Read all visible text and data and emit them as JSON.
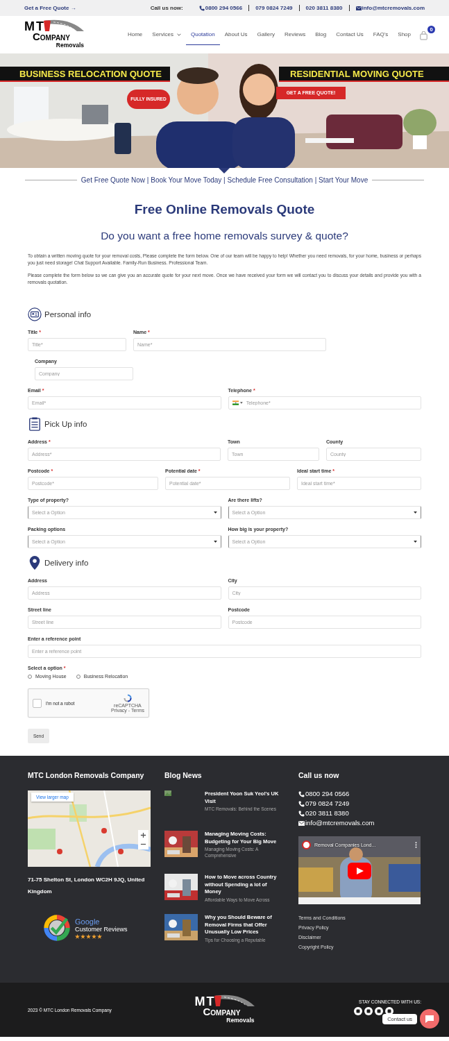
{
  "topbar": {
    "quote_link": "Get a Free Quote →",
    "call_label": "Call us now:",
    "phones": [
      "0800 294 0566",
      "079 0824 7249",
      "020 3811 8380"
    ],
    "email": "info@mtcremovals.com"
  },
  "header": {
    "logo": {
      "mark": "MT",
      "name": "COMPANY",
      "sub": "Removals"
    },
    "nav": [
      {
        "label": "Home",
        "selected": false,
        "dropdown": false
      },
      {
        "label": "Services",
        "selected": false,
        "dropdown": true
      },
      {
        "label": "Quotation",
        "selected": true,
        "dropdown": false
      },
      {
        "label": "About Us",
        "selected": false,
        "dropdown": false
      },
      {
        "label": "Gallery",
        "selected": false,
        "dropdown": false
      },
      {
        "label": "Reviews",
        "selected": false,
        "dropdown": false
      },
      {
        "label": "Blog",
        "selected": false,
        "dropdown": false
      },
      {
        "label": "Contact Us",
        "selected": false,
        "dropdown": false
      },
      {
        "label": "FAQ's",
        "selected": false,
        "dropdown": false
      },
      {
        "label": "Shop",
        "selected": false,
        "dropdown": false
      }
    ],
    "cart_count": "0"
  },
  "hero": {
    "kind": "picture",
    "left_banner": "BUSINESS RELOCATION QUOTE",
    "right_banner": "RESIDENTIAL MOVING QUOTE",
    "badge": "FULLY INSURED",
    "button": "GET A FREE QUOTE!"
  },
  "tagline": "Get Free Quote Now | Book Your Move Today | Schedule Free Consultation | Start Your Move",
  "title": "Free Online Removals Quote",
  "subtitle": "Do you want a free home removals survey & quote?",
  "intro": [
    "To obtain a written moving quote for your removal costs, Please complete the form below. One of our team will be happy to help! Whether you need removals, for your home, business or perhaps you just need storage! Chat Support Available. Family-Run Business. Professional Team.",
    "Please complete the form below so we can give you an accurate quote for your next move. Once we have received your form we will contact you to discuss your details and provide you with a removals quotation."
  ],
  "form": {
    "sections": [
      {
        "kind": "person",
        "title": "Personal info",
        "rows": [
          [
            {
              "kind": "text",
              "label": "Title",
              "mark": "*",
              "placeholder": "Title*"
            },
            {
              "kind": "text",
              "label": "Name",
              "mark": "*",
              "placeholder": "Name*"
            }
          ],
          [
            {
              "kind": "text",
              "label": "Company",
              "placeholder": "Company"
            }
          ],
          [
            {
              "kind": "text",
              "label": "Email",
              "mark": "*",
              "placeholder": "Email*"
            },
            {
              "kind": "phone",
              "label": "Telephone",
              "mark": "*",
              "placeholder": "Telephone*"
            }
          ]
        ]
      },
      {
        "kind": "list",
        "title": "Pick Up info",
        "rows": [
          [
            {
              "kind": "text",
              "label": "Address",
              "mark": "*",
              "placeholder": "Address*"
            },
            {
              "kind": "text",
              "label": "Town",
              "placeholder": "Town"
            },
            {
              "kind": "text",
              "label": "County",
              "placeholder": "County"
            }
          ],
          [
            {
              "kind": "text",
              "label": "Postcode",
              "mark": "*",
              "placeholder": "Postcode*"
            },
            {
              "kind": "text",
              "label": "Potential date",
              "mark": "*",
              "placeholder": "Potential date*"
            },
            {
              "kind": "text",
              "label": "Ideal start time",
              "mark": "*",
              "placeholder": "Ideal start time*"
            }
          ],
          [
            {
              "kind": "select",
              "label": "Type of property?",
              "placeholder": "Select a Option"
            },
            {
              "kind": "select",
              "label": "Are there lifts?",
              "placeholder": "Select a Option"
            }
          ],
          [
            {
              "kind": "select",
              "label": "Packing options",
              "placeholder": "Select a Option"
            },
            {
              "kind": "select",
              "label": "How big is your property?",
              "placeholder": "Select a Option"
            }
          ]
        ]
      },
      {
        "kind": "pin",
        "title": "Delivery info",
        "rows": [
          [
            {
              "kind": "text",
              "label": "Address",
              "placeholder": "Address"
            },
            {
              "kind": "text",
              "label": "City",
              "placeholder": "City"
            }
          ],
          [
            {
              "kind": "text",
              "label": "Street line",
              "placeholder": "Street line"
            },
            {
              "kind": "text",
              "label": "Postcode",
              "placeholder": "Postcode"
            }
          ],
          [
            {
              "kind": "text",
              "label": "Enter a reference point",
              "placeholder": "Enter a reference point"
            }
          ]
        ]
      }
    ],
    "choice": {
      "label": "Select a option",
      "mark": "*",
      "options": [
        {
          "label": "Moving House",
          "selected": false
        },
        {
          "label": "Business Relocation",
          "selected": false
        }
      ]
    },
    "captcha": {
      "label": "I'm not a robot",
      "checked": false,
      "brand": "reCAPTCHA",
      "links": "Privacy - Terms"
    },
    "submit": "Send"
  },
  "footer": {
    "company": {
      "title": "MTC London Removals Company",
      "map_button": "View larger map",
      "address": "71-75 Shelton St, London WC2H 9JQ, United Kingdom",
      "reviews": {
        "brand": "Google",
        "label": "Customer Reviews",
        "stars": 5
      }
    },
    "blog": {
      "title": "Blog News",
      "posts": [
        {
          "title": "President Yoon Suk Yeol's UK Visit",
          "excerpt": "MTC Removals: Behind the Scenes"
        },
        {
          "title": "Managing Moving Costs: Budgeting for Your Big Move",
          "excerpt": "Managing Moving Costs: A Comprehensive"
        },
        {
          "title": "How to Move across Country without Spending a lot of Money",
          "excerpt": "Affordable Ways to Move Across"
        },
        {
          "title": "Why you Should Beware of Removal Firms that Offer Unusually Low Prices",
          "excerpt": "Tips for Choosing a Reputable"
        }
      ]
    },
    "contact": {
      "title": "Call us now",
      "phones": [
        "0800 294 0566",
        "079 0824 7249",
        "020 3811 8380"
      ],
      "email": "info@mtcremovals.com",
      "video_title": "Removal Companies Lond...",
      "links": [
        "Terms and Conditions",
        "Privacy Policy",
        "Disclaimer",
        "Copyright Policy"
      ]
    }
  },
  "bottom": {
    "copyright": "2023 © MTC London Removals Company",
    "logo": {
      "mark": "MT",
      "name": "COMPANY",
      "sub": "Removals"
    },
    "social_label": "STAY CONNECTED WITH US:",
    "chat": "Contact us"
  }
}
